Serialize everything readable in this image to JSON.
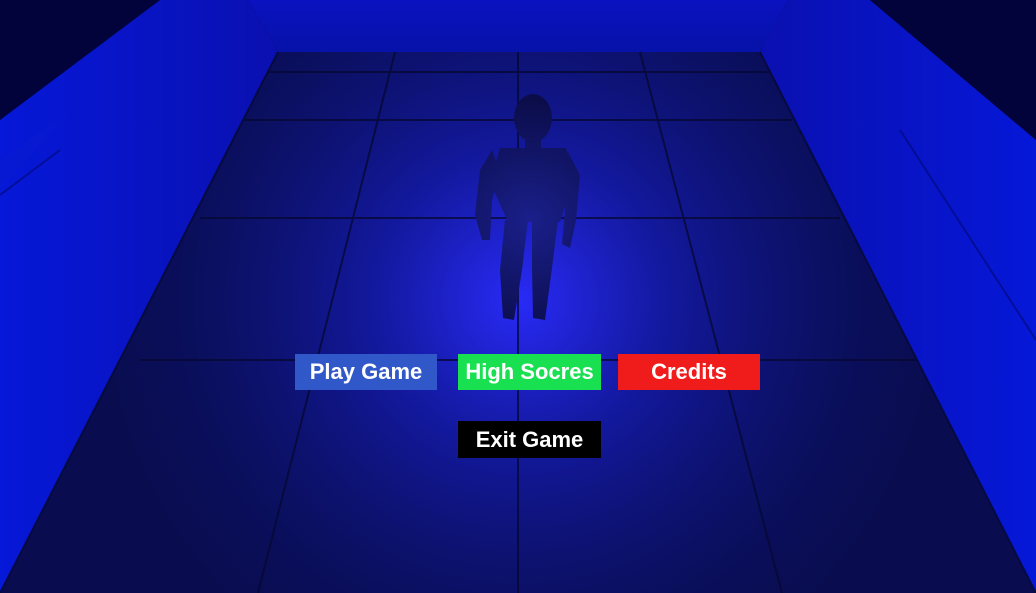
{
  "menu": {
    "play_label": "Play Game",
    "high_scores_label": "High Socres",
    "credits_label": "Credits",
    "exit_label": "Exit Game"
  },
  "colors": {
    "play_button": "#3058c8",
    "high_scores_button": "#18e050",
    "credits_button": "#f01c1c",
    "exit_button": "#000000",
    "wall": "#0a16c8",
    "floor": "#0c1060",
    "spotlight": "#2a2cff"
  },
  "scene": {
    "character": "humanoid-figure"
  }
}
